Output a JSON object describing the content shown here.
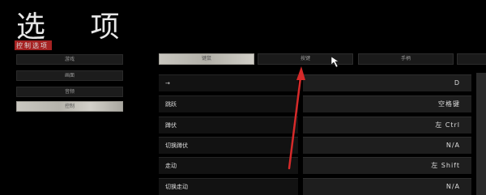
{
  "header": {
    "title": "选 项",
    "subtitle": "控制选项"
  },
  "left_menu": {
    "items": [
      {
        "label": "游戏"
      },
      {
        "label": "画面"
      },
      {
        "label": "音频"
      },
      {
        "label": "控制"
      }
    ]
  },
  "tabs": [
    {
      "label": "键鼠"
    },
    {
      "label": "按键"
    },
    {
      "label": "手柄"
    },
    {
      "label": ""
    }
  ],
  "bindings": [
    {
      "action": "→",
      "key": "D"
    },
    {
      "action": "跳跃",
      "key": "空格键"
    },
    {
      "action": "蹲伏",
      "key": "左 Ctrl"
    },
    {
      "action": "切换蹲伏",
      "key": "N/A"
    },
    {
      "action": "走动",
      "key": "左 Shift"
    },
    {
      "action": "切换走动",
      "key": "N/A"
    }
  ],
  "colors": {
    "accent": "#a52222",
    "annotation_arrow": "#d62a2a"
  },
  "icons": [
    "mouse-cursor-icon",
    "annotation-arrow"
  ]
}
